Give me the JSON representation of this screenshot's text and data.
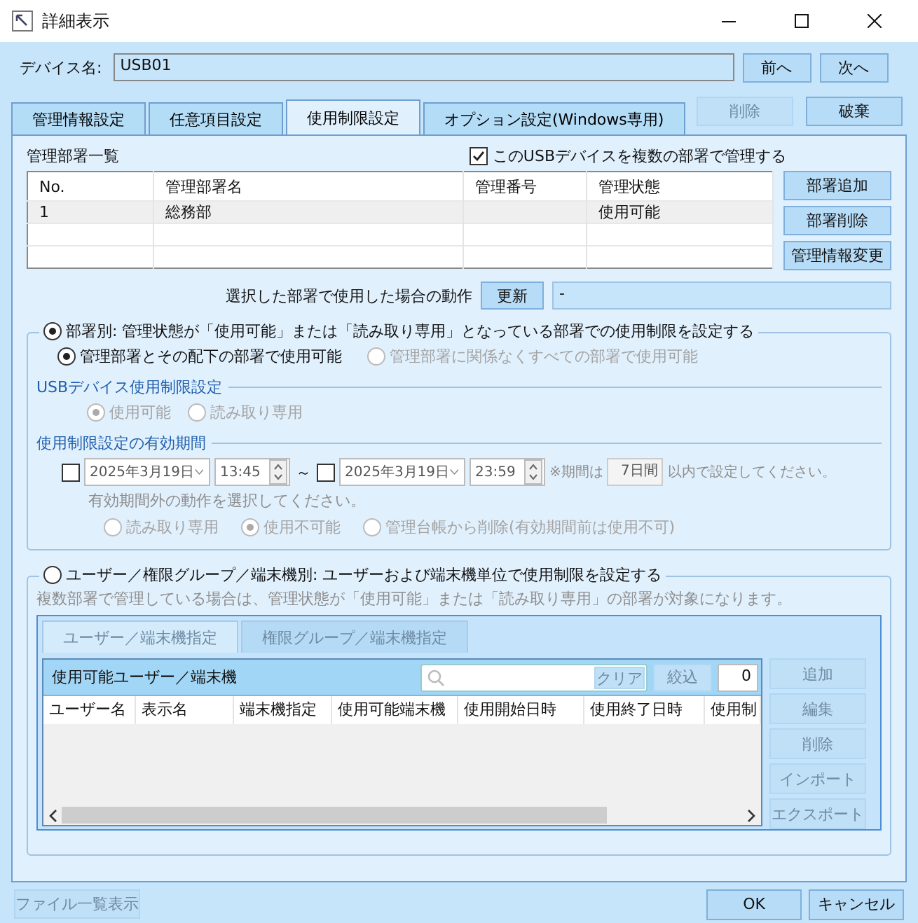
{
  "window": {
    "title": "詳細表示"
  },
  "device": {
    "label": "デバイス名:",
    "value": "USB01"
  },
  "nav_buttons": [
    {
      "label": "前へ",
      "disabled": false
    },
    {
      "label": "次へ",
      "disabled": false
    }
  ],
  "tabs": [
    {
      "label": "管理情報設定",
      "selected": false
    },
    {
      "label": "任意項目設定",
      "selected": false
    },
    {
      "label": "使用制限設定",
      "selected": true
    },
    {
      "label": "オプション設定(Windows専用)",
      "selected": false
    }
  ],
  "action_buttons": [
    {
      "label": "削除",
      "disabled": true
    },
    {
      "label": "破棄",
      "disabled": false
    }
  ],
  "departments": {
    "title": "管理部署一覧",
    "multi_checkbox": {
      "label": "このUSBデバイスを複数の部署で管理する",
      "checked": true
    },
    "columns": [
      "No.",
      "管理部署名",
      "管理番号",
      "管理状態"
    ],
    "rows": [
      {
        "cells": [
          "1",
          "総務部",
          null,
          "使用可能"
        ],
        "selected": true
      }
    ],
    "buttons": [
      {
        "label": "部署追加",
        "disabled": false
      },
      {
        "label": "部署削除",
        "disabled": false
      },
      {
        "label": "管理情報変更",
        "disabled": false
      }
    ]
  },
  "action": {
    "label": "選択した部署で使用した場合の動作",
    "button": {
      "label": "更新",
      "disabled": false
    },
    "value": "-"
  },
  "department_mode": {
    "radio": {
      "label": "部署別: 管理状態が「使用可能」または「読み取り専用」となっている部署での使用制限を設定する",
      "selected": true
    },
    "scope": [
      {
        "label": "管理部署とその配下の部署で使用可能",
        "selected": true,
        "disabled": false
      },
      {
        "label": "管理部署に関係なくすべての部署で使用可能",
        "selected": false,
        "disabled": true
      }
    ],
    "usb_setting": {
      "title": "USBデバイス使用制限設定",
      "options": [
        {
          "label": "使用可能",
          "selected": true,
          "disabled": true
        },
        {
          "label": "読み取り専用",
          "selected": false,
          "disabled": true
        }
      ]
    },
    "period": {
      "title": "使用制限設定の有効期間",
      "start": {
        "checked": false,
        "date": "2025年3月19日",
        "time": "13:45"
      },
      "separator": "～",
      "end": {
        "checked": false,
        "date": "2025年3月19日",
        "time": "23:59"
      },
      "note_prefix": "※期間は",
      "days": "7日間",
      "note_suffix": "以内で設定してください。",
      "hint": "有効期間外の動作を選択してください。",
      "options": [
        {
          "label": "読み取り専用",
          "selected": false,
          "disabled": true
        },
        {
          "label": "使用不可能",
          "selected": true,
          "disabled": true
        },
        {
          "label": "管理台帳から削除(有効期間前は使用不可)",
          "selected": false,
          "disabled": true
        }
      ]
    }
  },
  "user_mode": {
    "radio": {
      "label": "ユーザー／権限グループ／端末機別: ユーザーおよび端末機単位で使用制限を設定する",
      "selected": false
    },
    "note": "複数部署で管理している場合は、管理状態が「使用可能」または「読み取り専用」の部署が対象になります。",
    "subtabs": [
      {
        "label": "ユーザー／端末機指定",
        "selected": true
      },
      {
        "label": "権限グループ／端末機指定",
        "selected": false
      }
    ],
    "list": {
      "title": "使用可能ユーザー／端末機",
      "clear": {
        "label": "クリア",
        "disabled": true
      },
      "filter": {
        "label": "絞込",
        "disabled": true
      },
      "count": "0",
      "columns": [
        "ユーザー名",
        "表示名",
        "端末機指定",
        "使用可能端末機",
        "使用開始日時",
        "使用終了日時",
        "使用制"
      ]
    },
    "buttons": [
      {
        "label": "追加",
        "disabled": true
      },
      {
        "label": "編集",
        "disabled": true
      },
      {
        "label": "削除",
        "disabled": true
      },
      {
        "label": "インポート",
        "disabled": true
      },
      {
        "label": "エクスポート",
        "disabled": true
      }
    ]
  },
  "footer": {
    "file_list": {
      "label": "ファイル一覧表示",
      "disabled": true
    },
    "ok": {
      "label": "OK",
      "disabled": false
    },
    "cancel": {
      "label": "キャンセル",
      "disabled": false
    }
  }
}
